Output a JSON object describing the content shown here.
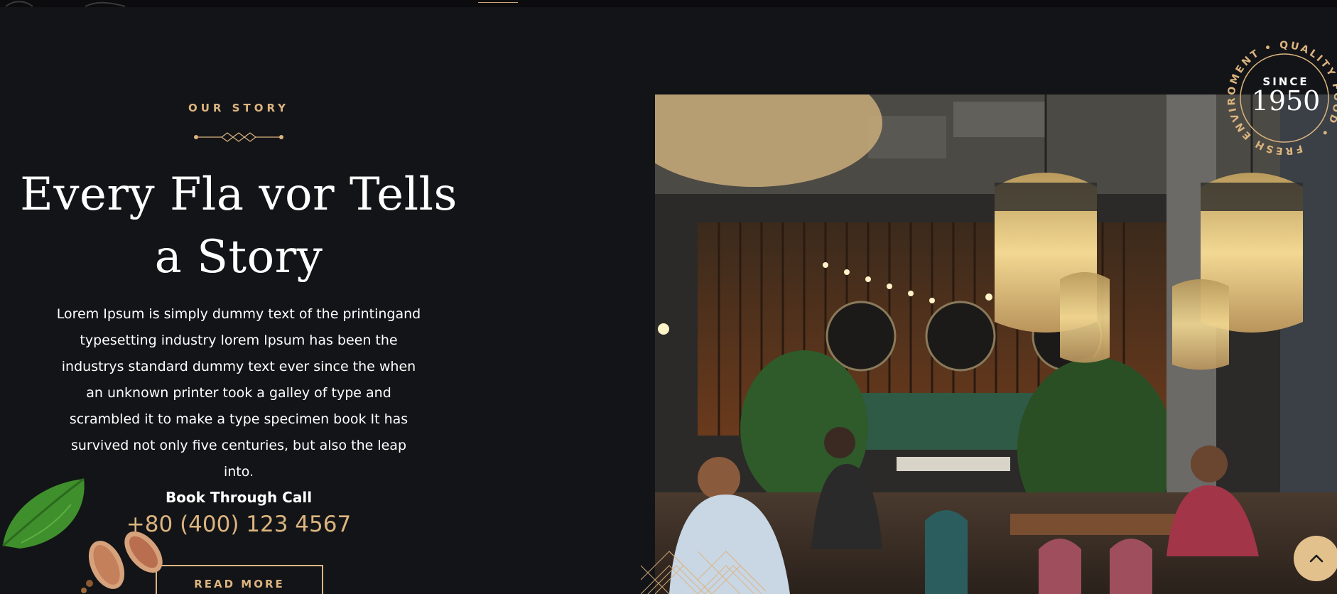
{
  "story": {
    "eyebrow": "OUR STORY",
    "headline": "Every Fla vor Tells a Story",
    "body": "Lorem Ipsum is simply dummy text of the printingand typesetting industry lorem Ipsum has been the industrys standard dummy text ever since the when an unknown printer took a galley of type and scrambled it to make a type specimen book It has survived not only five centuries, but also the leap into.",
    "book_label": "Book Through Call",
    "phone": "+80 (400) 123 4567",
    "read_more_label": "READ MORE"
  },
  "badge": {
    "since_label": "SINCE",
    "year": "1950",
    "ring_text": "FRESH ENVIROMENT • QUALITY FOOD •"
  },
  "icons": {
    "divider": "diamond-divider-icon",
    "scroll_top": "chevron-up-icon",
    "decor_basil": "basil-leaf-icon",
    "decor_garlic": "garlic-icon"
  },
  "colors": {
    "background": "#131417",
    "accent_gold": "#dcb47f",
    "text": "#ffffff",
    "scroll_button": "#e3c18d"
  }
}
